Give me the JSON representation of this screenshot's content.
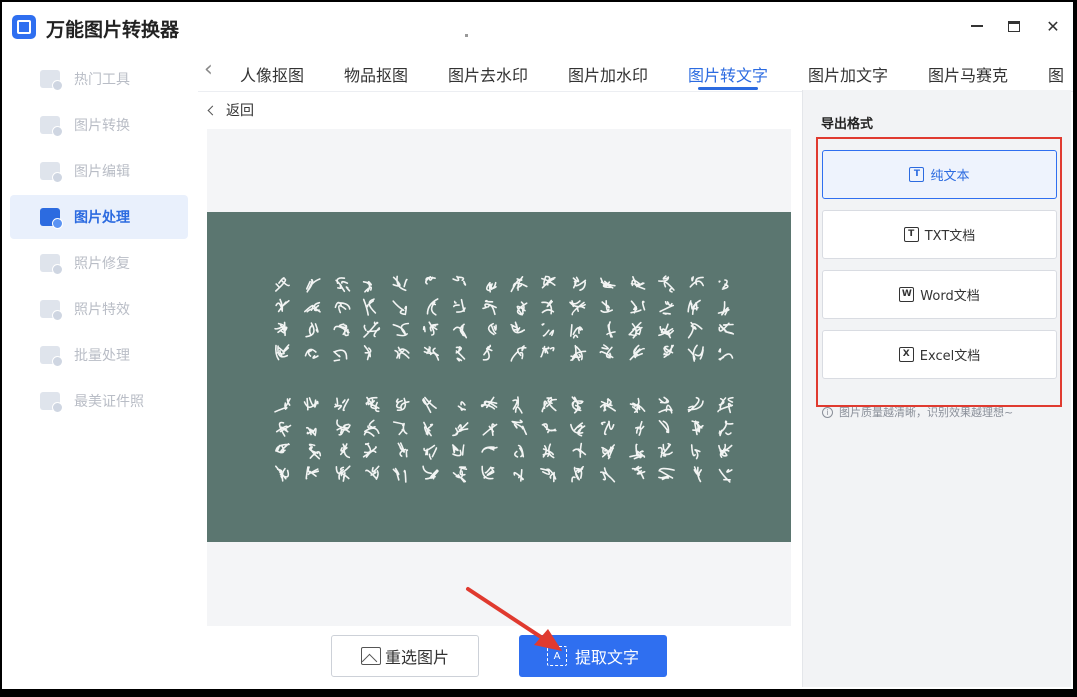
{
  "app": {
    "title": "万能图片转换器"
  },
  "window_controls": {
    "minimize": "—",
    "maximize": "□",
    "close": "✕"
  },
  "sidebar": {
    "items": [
      {
        "label": "热门工具",
        "icon": "grid-icon",
        "active": false
      },
      {
        "label": "图片转换",
        "icon": "image-convert-icon",
        "active": false
      },
      {
        "label": "图片编辑",
        "icon": "image-edit-icon",
        "active": false
      },
      {
        "label": "图片处理",
        "icon": "image-process-icon",
        "active": true
      },
      {
        "label": "照片修复",
        "icon": "photo-repair-icon",
        "active": false
      },
      {
        "label": "照片特效",
        "icon": "photo-effect-icon",
        "active": false
      },
      {
        "label": "批量处理",
        "icon": "batch-icon",
        "active": false
      },
      {
        "label": "最美证件照",
        "icon": "id-photo-icon",
        "active": false
      }
    ]
  },
  "tabs": {
    "items": [
      {
        "label": "人像抠图"
      },
      {
        "label": "物品抠图"
      },
      {
        "label": "图片去水印"
      },
      {
        "label": "图片加水印"
      },
      {
        "label": "图片转文字",
        "active": true
      },
      {
        "label": "图片加文字"
      },
      {
        "label": "图片马赛克"
      },
      {
        "label": "图"
      }
    ]
  },
  "main": {
    "back_label": "返回",
    "preview_image": "calligraphy-text-image"
  },
  "actions": {
    "reselect_label": "重选图片",
    "extract_label": "提取文字"
  },
  "export": {
    "title": "导出格式",
    "formats": [
      {
        "label": "纯文本",
        "icon": "text-icon",
        "selected": true
      },
      {
        "label": "TXT文档",
        "icon": "txt-icon",
        "selected": false
      },
      {
        "label": "Word文档",
        "icon": "word-icon",
        "selected": false
      },
      {
        "label": "Excel文档",
        "icon": "excel-icon",
        "selected": false
      }
    ],
    "hint": "图片质量越清晰，识别效果越理想~"
  },
  "colors": {
    "accent": "#2f6ff0",
    "highlight_box": "#e03a2f",
    "preview_bg": "#5b7670"
  }
}
